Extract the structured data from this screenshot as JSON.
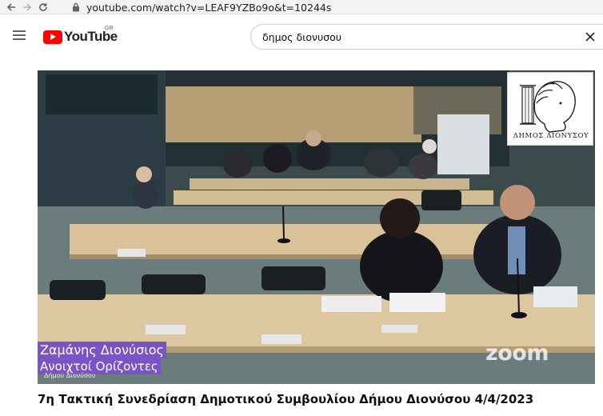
{
  "browser": {
    "url": "youtube.com/watch?v=LEAF9YZBo9o&t=10244s",
    "back_icon": "arrow-left-icon",
    "forward_icon": "arrow-right-icon",
    "reload_icon": "reload-icon",
    "lock_icon": "lock-icon"
  },
  "header": {
    "menu_icon": "hamburger-menu-icon",
    "logo_text": "YouTube",
    "region_code": "GR",
    "search_value": "δημος διονυσου",
    "clear_icon": "close-icon"
  },
  "video": {
    "overlay_name": "Ζαμάνης Διονύσιος",
    "overlay_party": "Ανοιχτοί Ορίζοντες",
    "overlay_small": "Δήμου Διονύσου",
    "watermark": "zoom",
    "municipality_logo_text": "ΔΗΜΟΣ ΔΙΟΝΥΣΟΥ",
    "colors": {
      "overlay": "#7a53c6",
      "brand_red": "#ff0000"
    }
  },
  "title": "7η Τακτική Συνεδρίαση Δημοτικού Συμβουλίου Δήμου Διονύσου 4/4/2023"
}
